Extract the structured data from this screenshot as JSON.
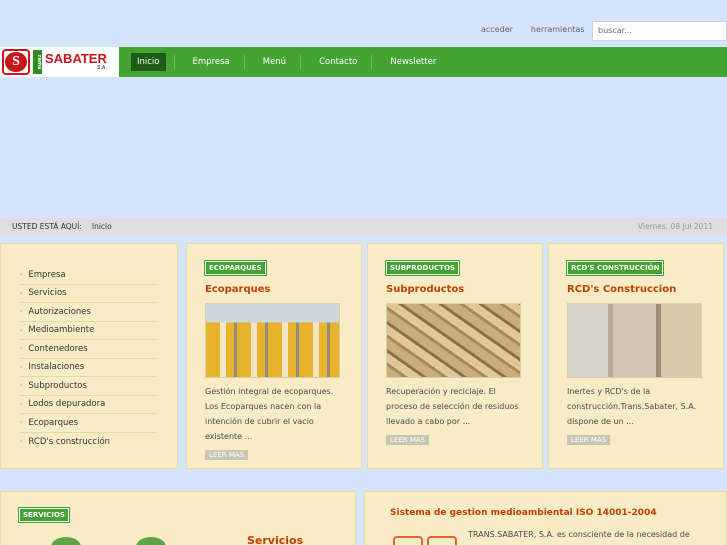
{
  "header": {
    "links": [
      "acceder",
      "herramientas"
    ],
    "search_placeholder": "buscar..."
  },
  "logo": {
    "badge_letter": "S",
    "mark": "rama",
    "name": "SABATER",
    "suffix": "S.A."
  },
  "nav": {
    "items": [
      "Inicio",
      "Empresa",
      "Menú",
      "Contacto",
      "Newsletter"
    ]
  },
  "breadcrumb": {
    "label": "USTED ESTÁ AQUÍ:",
    "current": "Inicio",
    "date": "Viernes, 08 Jul 2011"
  },
  "sidebar": {
    "items": [
      "Empresa",
      "Servicios",
      "Autorizaciones",
      "Medioambiente",
      "Contenedores",
      "Instalaciones",
      "Subproductos",
      "Lodos depuradora",
      "Ecoparques",
      "RCD's construcción"
    ]
  },
  "cards": [
    {
      "tag": "ECOPARQUES",
      "title": "Ecoparques",
      "text": "Gestión integral de ecoparques. Los Ecoparques nacen con la intención de cubrir el vacio existente ...",
      "more": "LEER MAS"
    },
    {
      "tag": "SUBPRODUCTOS",
      "title": "Subproductos",
      "text": "Recuperación y reciclaje. El proceso de selección de residuos llevado a cabo por ...",
      "more": "LEER MAS"
    },
    {
      "tag": "RCD'S CONSTRUCCIÓN",
      "title": "RCD's Construccion",
      "text": "Inertes y RCD's de la construcción.Trans.Sabater, S.A. dispone de un ...",
      "more": "LEER MAS"
    }
  ],
  "servicios": {
    "tag": "SERVICIOS",
    "title": "Servicios"
  },
  "iso": {
    "title": "Sistema de gestion medioambiental ISO 14001-2004",
    "text": "TRANS.SABATER, S.A. es consciente de la necesidad de"
  },
  "colors": {
    "nav_green": "#43a333",
    "nav_active": "#1d5b16",
    "title_orange": "#c04000",
    "panel_bg": "#f7ecc6",
    "page_bg": "#d5e3fb",
    "logo_red": "#c8161d"
  }
}
